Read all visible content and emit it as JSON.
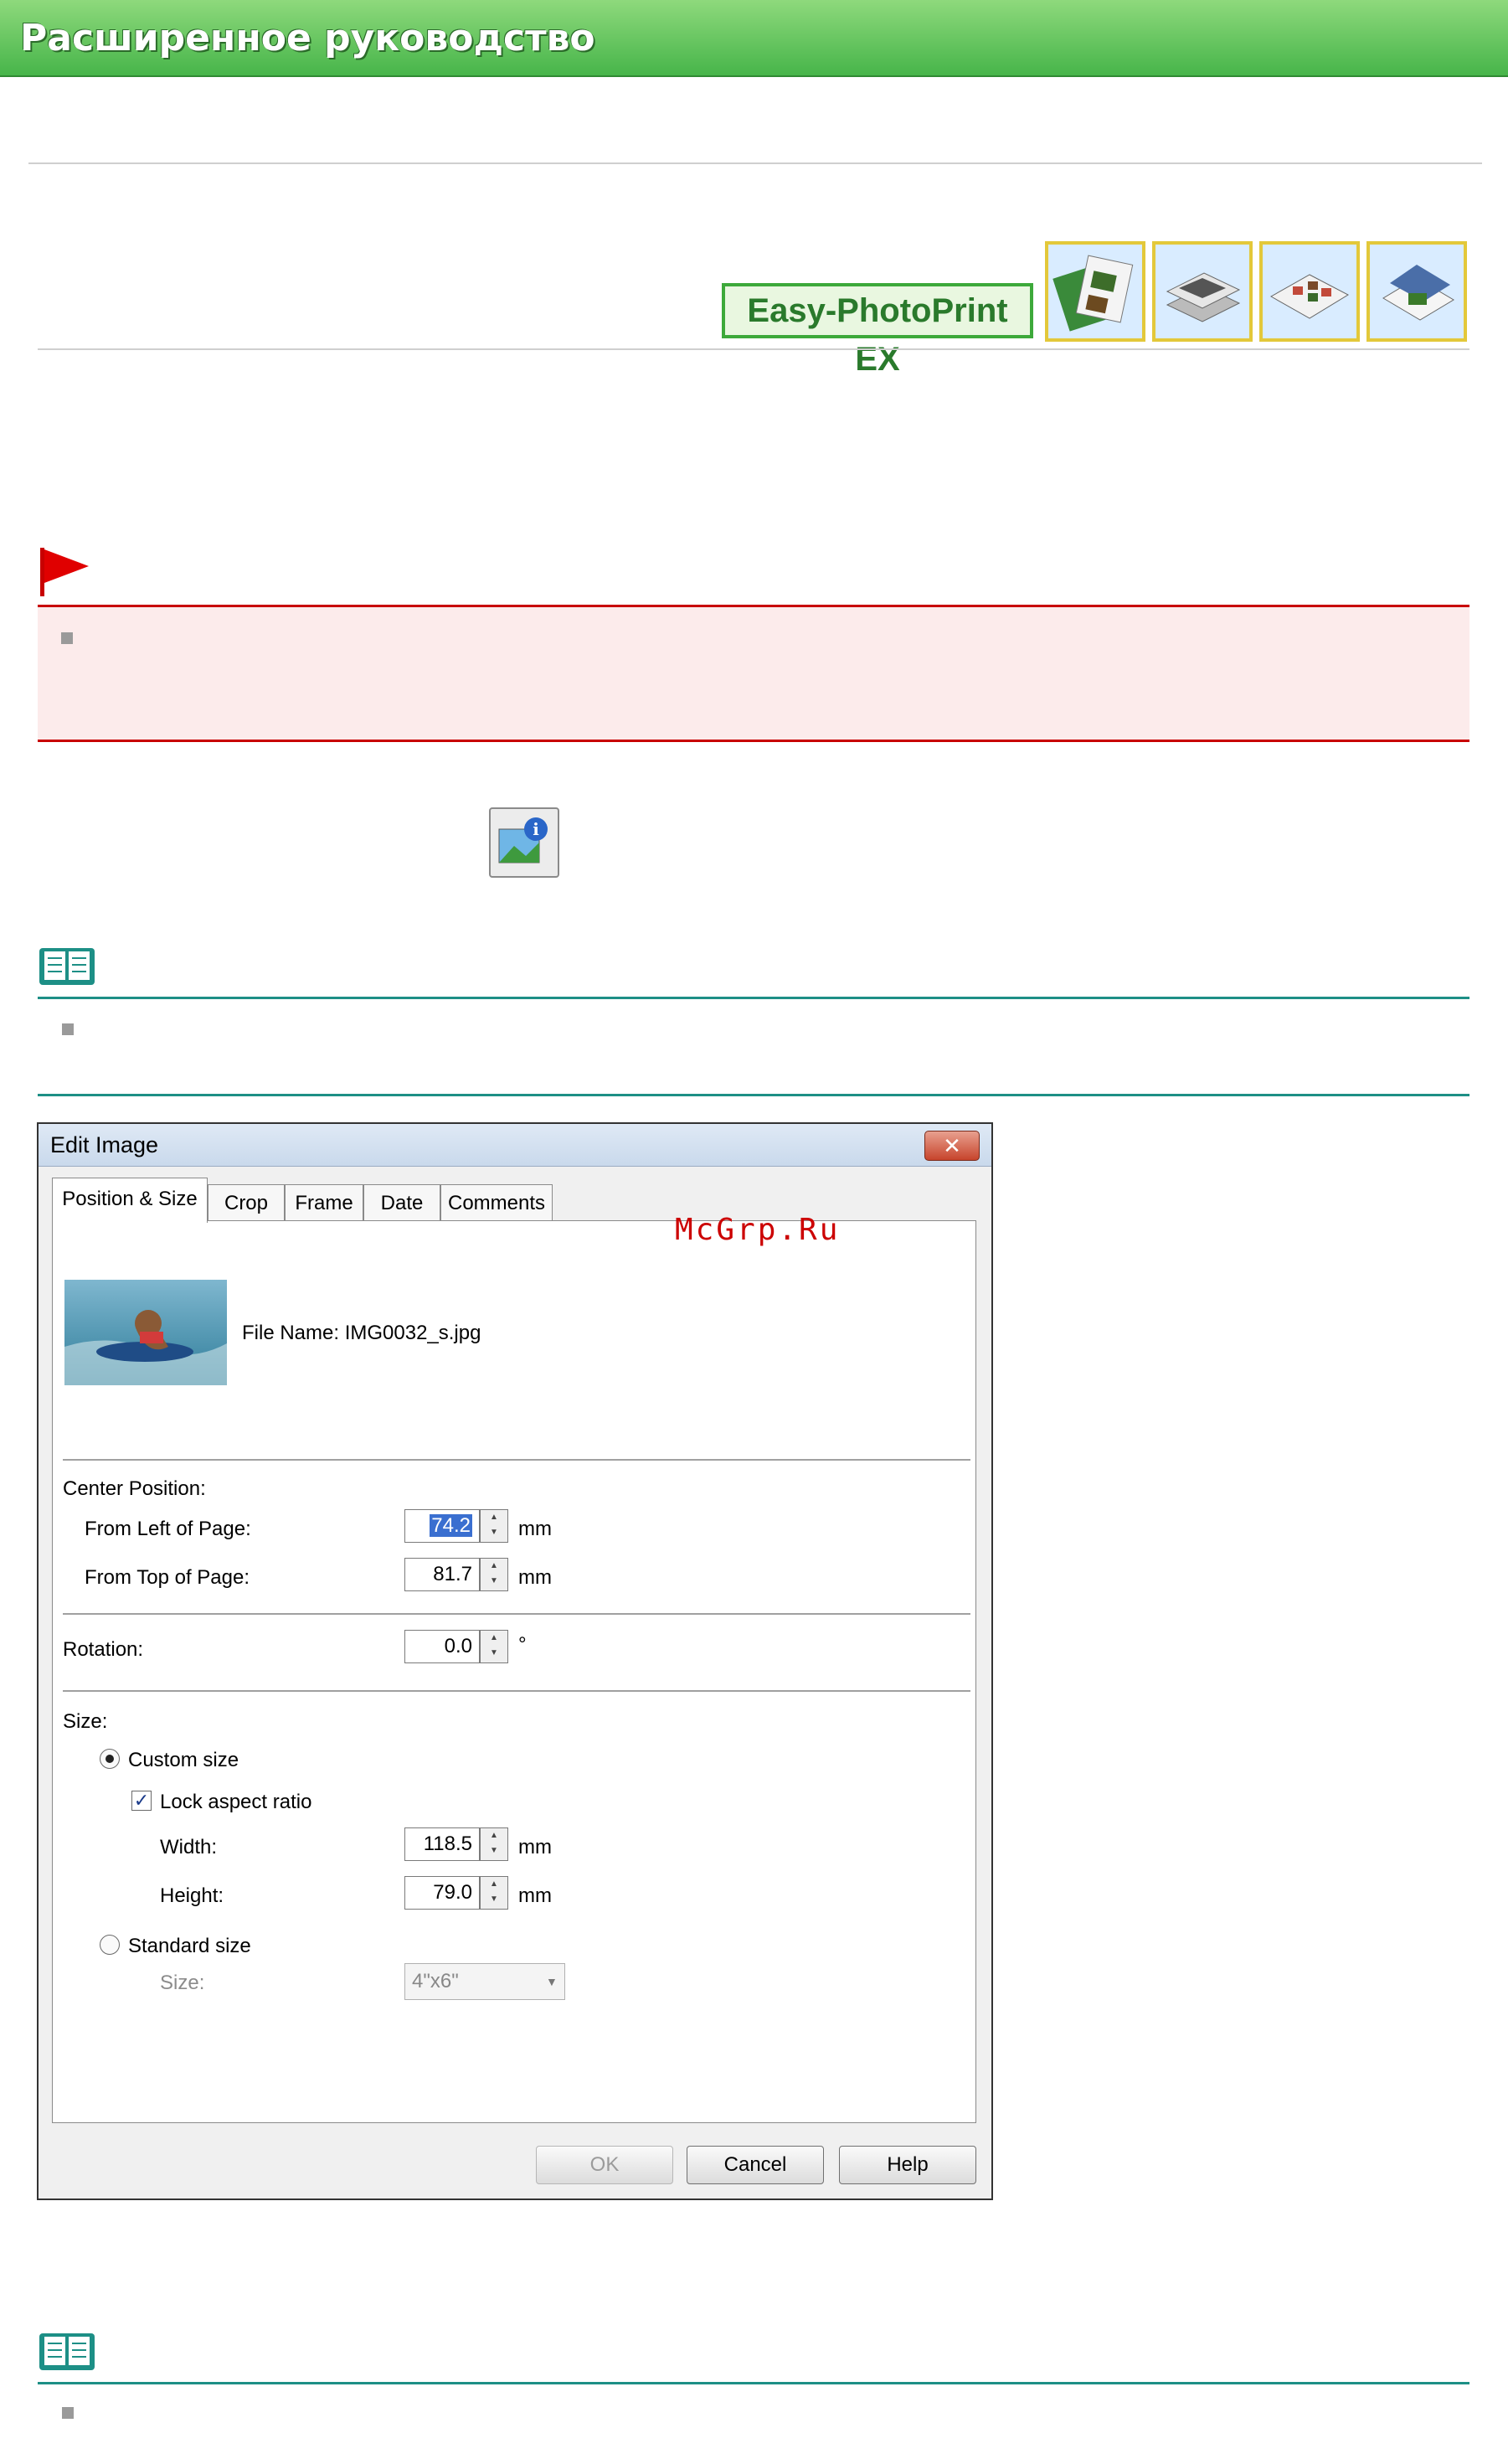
{
  "header": {
    "title": "Расширенное руководство"
  },
  "product": {
    "name": "Easy-PhotoPrint EX"
  },
  "dialog": {
    "title": "Edit Image",
    "close_symbol": "✕",
    "tabs": [
      "Position & Size",
      "Crop",
      "Frame",
      "Date",
      "Comments"
    ],
    "file_name": "File Name: IMG0032_s.jpg",
    "center_position": {
      "label": "Center Position:",
      "from_left_label": "From Left of Page:",
      "from_left_value": "74.2",
      "from_top_label": "From Top of Page:",
      "from_top_value": "81.7",
      "unit": "mm"
    },
    "rotation": {
      "label": "Rotation:",
      "value": "0.0",
      "unit": "°"
    },
    "size": {
      "label": "Size:",
      "custom_label": "Custom size",
      "lock_label": "Lock aspect ratio",
      "width_label": "Width:",
      "width_value": "118.5",
      "height_label": "Height:",
      "height_value": "79.0",
      "unit": "mm",
      "standard_label": "Standard size",
      "standard_size_label": "Size:",
      "standard_size_value": "4\"x6\""
    },
    "buttons": {
      "ok": "OK",
      "cancel": "Cancel",
      "help": "Help"
    }
  },
  "watermark": "McGrp.Ru",
  "colors": {
    "header_green": "#47b54a",
    "important_red": "#c80000",
    "note_teal": "#1d8f86"
  }
}
